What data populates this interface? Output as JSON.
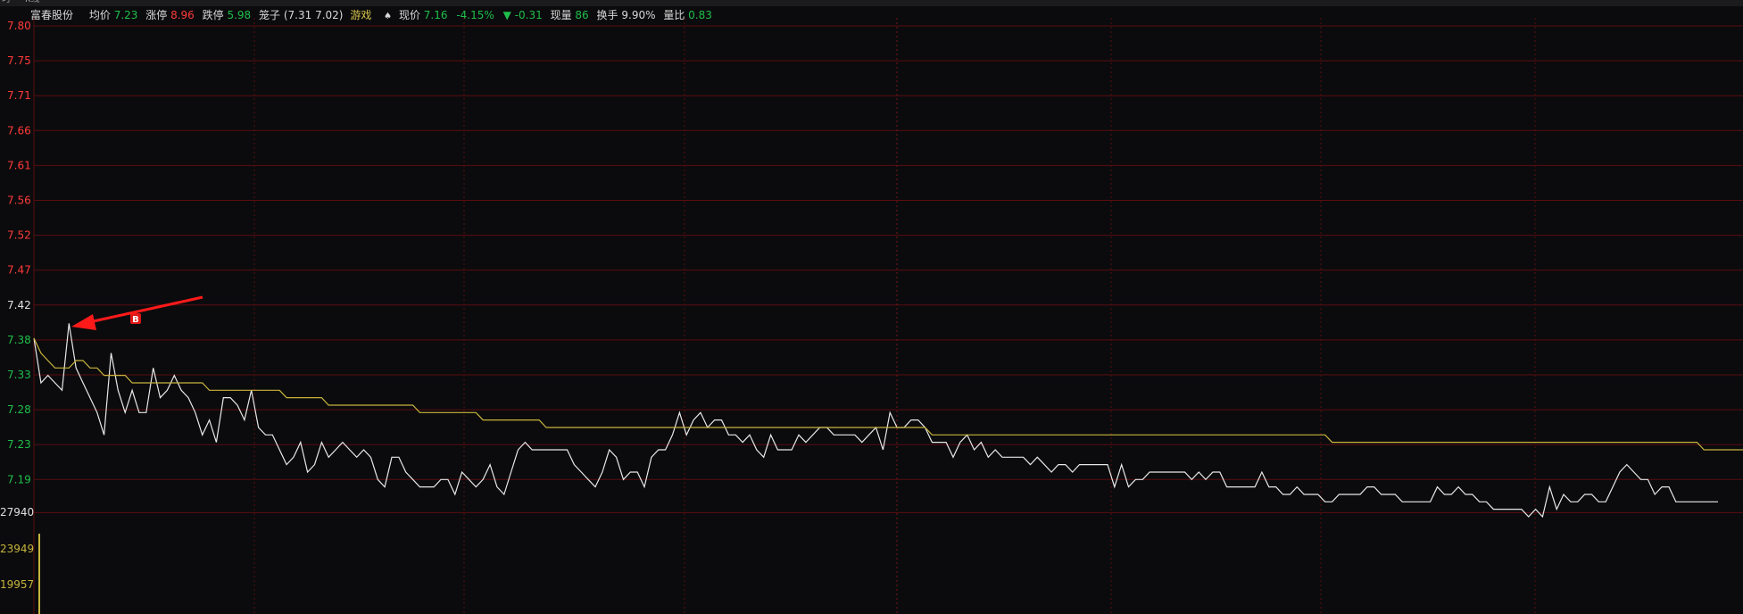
{
  "top_tabs": [
    "时",
    "K线"
  ],
  "header": {
    "stock_name": "富春股份",
    "avg_label": "均价",
    "avg_value": "7.23",
    "limit_up_label": "涨停",
    "limit_up_value": "8.96",
    "limit_down_label": "跌停",
    "limit_down_value": "5.98",
    "cage_label": "笼子",
    "cage_values": "(7.31 7.02)",
    "sector": "游戏",
    "spade_icon": "♠",
    "price_label": "现价",
    "price_value": "7.16",
    "change_pct": "-4.15%",
    "change_arrow": "▼",
    "change_value": "-0.31",
    "vol_label": "现量",
    "vol_value": "86",
    "turnover_label": "换手",
    "turnover_value": "9.90%",
    "vol_ratio_label": "量比",
    "vol_ratio_value": "0.83"
  },
  "colors": {
    "up": "#ff3a3a",
    "down": "#1fbf4a",
    "price_line": "#e8e8e8",
    "avg_line": "#c8b43c",
    "grid": "#5a0d10",
    "arrow": "#ff1a1a"
  },
  "chart_data": {
    "type": "line",
    "title": "",
    "xlabel": "",
    "ylabel": "",
    "ylim": [
      7.15,
      7.8
    ],
    "y_ticks": [
      "7.80",
      "7.75",
      "7.71",
      "7.66",
      "7.61",
      "7.56",
      "7.52",
      "7.47",
      "7.42",
      "7.38",
      "7.33",
      "7.28",
      "7.23",
      "7.19"
    ],
    "volume_ticks": [
      "27940",
      "23949",
      "19957"
    ],
    "grid": true,
    "marker": {
      "label": "B",
      "x": 15,
      "y": 7.38
    },
    "series": [
      {
        "key": "price",
        "values": [
          7.38,
          7.32,
          7.33,
          7.32,
          7.31,
          7.4,
          7.34,
          7.32,
          7.3,
          7.28,
          7.25,
          7.36,
          7.31,
          7.28,
          7.31,
          7.28,
          7.28,
          7.34,
          7.3,
          7.31,
          7.33,
          7.31,
          7.3,
          7.28,
          7.25,
          7.27,
          7.24,
          7.3,
          7.3,
          7.29,
          7.27,
          7.31,
          7.26,
          7.25,
          7.25,
          7.23,
          7.21,
          7.22,
          7.24,
          7.2,
          7.21,
          7.24,
          7.22,
          7.23,
          7.24,
          7.23,
          7.22,
          7.23,
          7.22,
          7.19,
          7.18,
          7.22,
          7.22,
          7.2,
          7.19,
          7.18,
          7.18,
          7.18,
          7.19,
          7.19,
          7.17,
          7.2,
          7.19,
          7.18,
          7.19,
          7.21,
          7.18,
          7.17,
          7.2,
          7.23,
          7.24,
          7.23,
          7.23,
          7.23,
          7.23,
          7.23,
          7.23,
          7.21,
          7.2,
          7.19,
          7.18,
          7.2,
          7.23,
          7.22,
          7.19,
          7.2,
          7.2,
          7.18,
          7.22,
          7.23,
          7.23,
          7.25,
          7.28,
          7.25,
          7.27,
          7.28,
          7.26,
          7.27,
          7.27,
          7.25,
          7.25,
          7.24,
          7.25,
          7.23,
          7.22,
          7.25,
          7.23,
          7.23,
          7.23,
          7.25,
          7.24,
          7.25,
          7.26,
          7.26,
          7.25,
          7.25,
          7.25,
          7.25,
          7.24,
          7.25,
          7.26,
          7.23,
          7.28,
          7.26,
          7.26,
          7.27,
          7.27,
          7.26,
          7.24,
          7.24,
          7.24,
          7.22,
          7.24,
          7.25,
          7.23,
          7.24,
          7.22,
          7.23,
          7.22,
          7.22,
          7.22,
          7.22,
          7.21,
          7.22,
          7.21,
          7.2,
          7.21,
          7.21,
          7.2,
          7.21,
          7.21,
          7.21,
          7.21,
          7.21,
          7.18,
          7.21,
          7.18,
          7.19,
          7.19,
          7.2,
          7.2,
          7.2,
          7.2,
          7.2,
          7.2,
          7.19,
          7.2,
          7.19,
          7.2,
          7.2,
          7.18,
          7.18,
          7.18,
          7.18,
          7.18,
          7.2,
          7.18,
          7.18,
          7.17,
          7.17,
          7.18,
          7.17,
          7.17,
          7.17,
          7.16,
          7.16,
          7.17,
          7.17,
          7.17,
          7.17,
          7.18,
          7.18,
          7.17,
          7.17,
          7.17,
          7.16,
          7.16,
          7.16,
          7.16,
          7.16,
          7.18,
          7.17,
          7.17,
          7.18,
          7.17,
          7.17,
          7.16,
          7.16,
          7.15,
          7.15,
          7.15,
          7.15,
          7.15,
          7.14,
          7.15,
          7.14,
          7.18,
          7.15,
          7.17,
          7.16,
          7.16,
          7.17,
          7.17,
          7.16,
          7.16,
          7.18,
          7.2,
          7.21,
          7.2,
          7.19,
          7.19,
          7.17,
          7.18,
          7.18,
          7.16,
          7.16,
          7.16,
          7.16,
          7.16,
          7.16,
          7.16
        ]
      },
      {
        "key": "average",
        "values": [
          7.38,
          7.36,
          7.35,
          7.34,
          7.34,
          7.34,
          7.35,
          7.35,
          7.34,
          7.34,
          7.33,
          7.33,
          7.33,
          7.33,
          7.32,
          7.32,
          7.32,
          7.32,
          7.32,
          7.32,
          7.32,
          7.32,
          7.32,
          7.32,
          7.32,
          7.31,
          7.31,
          7.31,
          7.31,
          7.31,
          7.31,
          7.31,
          7.31,
          7.31,
          7.31,
          7.31,
          7.3,
          7.3,
          7.3,
          7.3,
          7.3,
          7.3,
          7.29,
          7.29,
          7.29,
          7.29,
          7.29,
          7.29,
          7.29,
          7.29,
          7.29,
          7.29,
          7.29,
          7.29,
          7.29,
          7.28,
          7.28,
          7.28,
          7.28,
          7.28,
          7.28,
          7.28,
          7.28,
          7.28,
          7.27,
          7.27,
          7.27,
          7.27,
          7.27,
          7.27,
          7.27,
          7.27,
          7.27,
          7.26,
          7.26,
          7.26,
          7.26,
          7.26,
          7.26,
          7.26,
          7.26,
          7.26,
          7.26,
          7.26,
          7.26,
          7.26,
          7.26,
          7.26,
          7.26,
          7.26,
          7.26,
          7.26,
          7.26,
          7.26,
          7.26,
          7.26,
          7.26,
          7.26,
          7.26,
          7.26,
          7.26,
          7.26,
          7.26,
          7.26,
          7.26,
          7.26,
          7.26,
          7.26,
          7.26,
          7.26,
          7.26,
          7.26,
          7.26,
          7.26,
          7.26,
          7.26,
          7.26,
          7.26,
          7.26,
          7.26,
          7.26,
          7.26,
          7.26,
          7.26,
          7.26,
          7.26,
          7.26,
          7.26,
          7.25,
          7.25,
          7.25,
          7.25,
          7.25,
          7.25,
          7.25,
          7.25,
          7.25,
          7.25,
          7.25,
          7.25,
          7.25,
          7.25,
          7.25,
          7.25,
          7.25,
          7.25,
          7.25,
          7.25,
          7.25,
          7.25,
          7.25,
          7.25,
          7.25,
          7.25,
          7.25,
          7.25,
          7.25,
          7.25,
          7.25,
          7.25,
          7.25,
          7.25,
          7.25,
          7.25,
          7.25,
          7.25,
          7.25,
          7.25,
          7.25,
          7.25,
          7.25,
          7.25,
          7.25,
          7.25,
          7.25,
          7.25,
          7.25,
          7.25,
          7.25,
          7.25,
          7.25,
          7.25,
          7.25,
          7.25,
          7.25,
          7.24,
          7.24,
          7.24,
          7.24,
          7.24,
          7.24,
          7.24,
          7.24,
          7.24,
          7.24,
          7.24,
          7.24,
          7.24,
          7.24,
          7.24,
          7.24,
          7.24,
          7.24,
          7.24,
          7.24,
          7.24,
          7.24,
          7.24,
          7.24,
          7.24,
          7.24,
          7.24,
          7.24,
          7.24,
          7.24,
          7.24,
          7.24,
          7.24,
          7.24,
          7.24,
          7.24,
          7.24,
          7.24,
          7.24,
          7.24,
          7.24,
          7.24,
          7.24,
          7.24,
          7.24,
          7.24,
          7.24,
          7.24,
          7.24,
          7.24,
          7.24,
          7.24,
          7.24,
          7.23,
          7.23,
          7.23,
          7.23,
          7.23,
          7.23,
          7.23,
          7.23,
          7.23,
          7.23,
          7.23,
          7.23,
          7.23,
          7.23,
          7.23,
          7.23,
          7.23
        ]
      }
    ]
  }
}
